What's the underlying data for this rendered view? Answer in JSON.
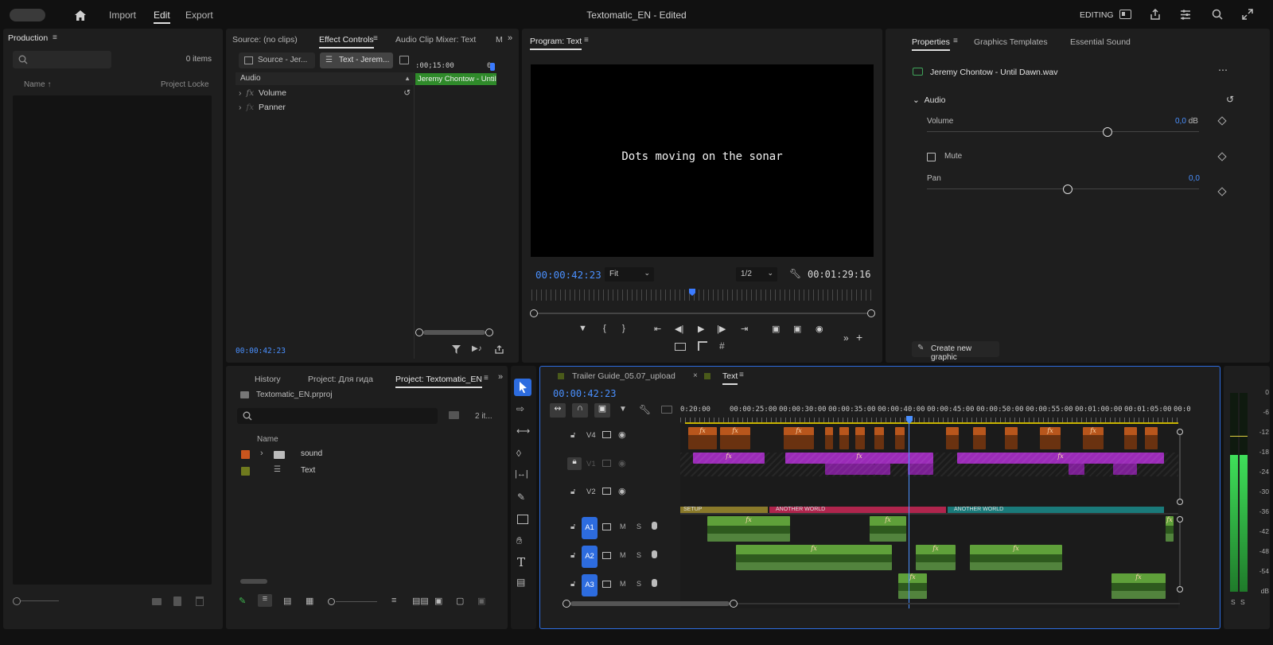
{
  "titlebar": {
    "nav_import": "Import",
    "nav_edit": "Edit",
    "nav_export": "Export",
    "doc_title": "Textomatic_EN - Edited",
    "workspace": "EDITING"
  },
  "production_panel": {
    "title": "Production",
    "items_count": "0 items",
    "col_name": "Name",
    "col_locked": "Project Locke"
  },
  "effect_controls": {
    "tabs": [
      "Source: (no clips)",
      "Effect Controls",
      "Audio Clip Mixer: Text",
      "M"
    ],
    "source_chip": "Source - Jer...",
    "text_chip": "Text - Jerem...",
    "section": "Audio",
    "effects": [
      "Volume",
      "Panner"
    ],
    "ruler_time": ":00;15:00",
    "ruler_end": "0",
    "clip_label": "Jeremy Chontow - Until",
    "timecode": "00:00:42:23"
  },
  "program": {
    "title": "Program: Text",
    "overlay_text": "Dots moving on the sonar",
    "timecode": "00:00:42:23",
    "fit": "Fit",
    "resolution": "1/2",
    "duration": "00:01:29:16"
  },
  "properties": {
    "tabs": [
      "Properties",
      "Graphics Templates",
      "Essential Sound"
    ],
    "clip_name": "Jeremy Chontow - Until Dawn.wav",
    "section": "Audio",
    "volume_label": "Volume",
    "volume_value": "0,0",
    "volume_unit": "dB",
    "mute_label": "Mute",
    "pan_label": "Pan",
    "pan_value": "0,0",
    "create_graphic": "Create new graphic"
  },
  "project_panel": {
    "tabs": [
      "History",
      "Project: Для гида",
      "Project: Textomatic_EN"
    ],
    "file": "Textomatic_EN.prproj",
    "count": "2 it...",
    "col_name": "Name",
    "items": [
      {
        "name": "sound",
        "color": "#c8551e",
        "type": "folder"
      },
      {
        "name": "Text",
        "color": "#6f7a1e",
        "type": "sequence"
      }
    ]
  },
  "timeline": {
    "tabs": [
      "Trailer Guide_05.07_upload",
      "Text"
    ],
    "timecode": "00:00:42:23",
    "ruler": [
      "0:20:00",
      "00:00:25:00",
      "00:00:30:00",
      "00:00:35:00",
      "00:00:40:00",
      "00:00:45:00",
      "00:00:50:00",
      "00:00:55:00",
      "00:01:00:00",
      "00:01:05:00",
      "00:0"
    ],
    "video_tracks": [
      "V4",
      "V1",
      "V2"
    ],
    "audio_tracks": [
      "A1",
      "A2",
      "A3"
    ],
    "track_m": "M",
    "track_s": "S",
    "subtitle_labels": [
      "SETUP",
      "ANOTHER WORLD",
      "ANOTHER WORLD"
    ],
    "fx": "fx"
  },
  "meter": {
    "scale": [
      "0",
      "-6",
      "-12",
      "-18",
      "-24",
      "-30",
      "-36",
      "-42",
      "-48",
      "-54",
      "dB"
    ],
    "solo": [
      "S",
      "S"
    ]
  },
  "colors": {
    "accent": "#2d6cdf",
    "orange_clip": "#b8561c",
    "purple_clip": "#9b2bb8",
    "green_clip": "#5fa03a"
  }
}
